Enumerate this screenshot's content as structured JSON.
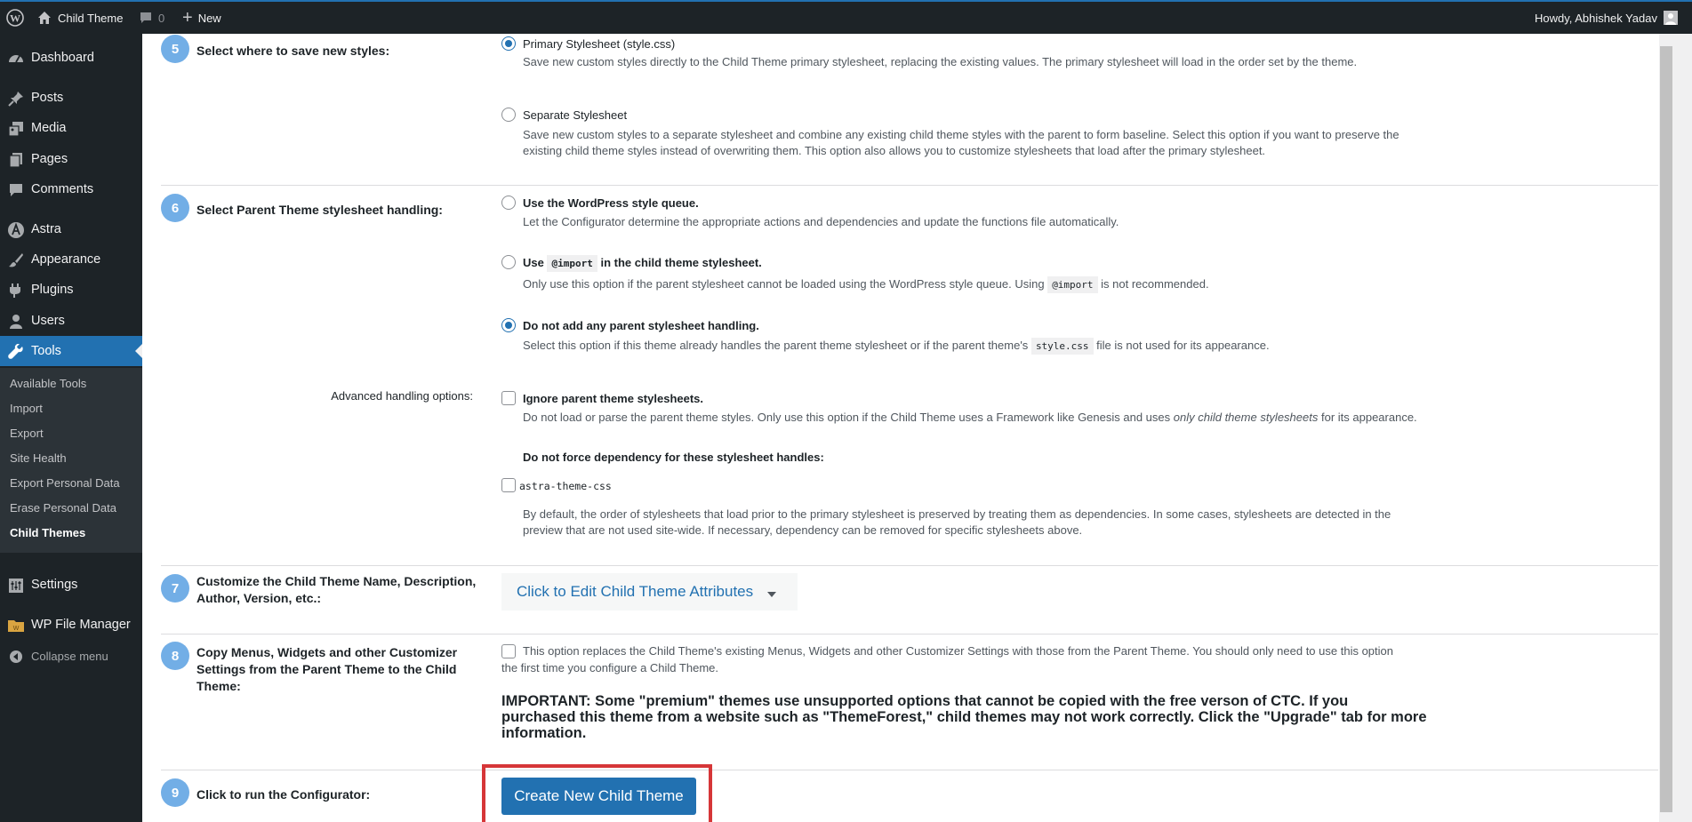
{
  "adminbar": {
    "site_name": "Child Theme",
    "comments_count": "0",
    "new_label": "New",
    "greeting": "Howdy, Abhishek Yadav"
  },
  "sidebar": {
    "items": [
      {
        "label": "Dashboard",
        "icon": "dashboard-icon"
      },
      {
        "label": "Posts",
        "icon": "pin-icon"
      },
      {
        "label": "Media",
        "icon": "media-icon"
      },
      {
        "label": "Pages",
        "icon": "pages-icon"
      },
      {
        "label": "Comments",
        "icon": "comment-icon"
      },
      {
        "label": "Astra",
        "icon": "astra-icon"
      },
      {
        "label": "Appearance",
        "icon": "brush-icon"
      },
      {
        "label": "Plugins",
        "icon": "plugin-icon"
      },
      {
        "label": "Users",
        "icon": "user-icon"
      },
      {
        "label": "Tools",
        "icon": "wrench-icon"
      }
    ],
    "submenu": [
      "Available Tools",
      "Import",
      "Export",
      "Site Health",
      "Export Personal Data",
      "Erase Personal Data",
      "Child Themes"
    ],
    "settings_label": "Settings",
    "file_manager_label": "WP File Manager",
    "collapse_label": "Collapse menu"
  },
  "steps": {
    "s5": {
      "number": "5",
      "label": "Select where to save new styles:",
      "opt1_title": "Primary Stylesheet (style.css)",
      "opt1_desc": "Save new custom styles directly to the Child Theme primary stylesheet, replacing the existing values. The primary stylesheet will load in the order set by the theme.",
      "opt2_title": "Separate Stylesheet",
      "opt2_desc_1": "Save new custom styles to a separate stylesheet and combine any existing child theme styles with the parent to form baseline. Select this option if you want to preserve the",
      "opt2_desc_2": "existing child theme styles instead of overwriting them. This option also allows you to customize stylesheets that load after the primary stylesheet."
    },
    "s6": {
      "number": "6",
      "label": "Select Parent Theme stylesheet handling:",
      "opt1_title": "Use the WordPress style queue.",
      "opt1_desc": "Let the Configurator determine the appropriate actions and dependencies and update the functions file automatically.",
      "opt2_pre": "Use",
      "opt2_code": "@import",
      "opt2_post": "in the child theme stylesheet.",
      "opt2_desc_pre": "Only use this option if the parent stylesheet cannot be loaded using the WordPress style queue. Using",
      "opt2_desc_code": "@import",
      "opt2_desc_post": "is not recommended.",
      "opt3_title": "Do not add any parent stylesheet handling.",
      "opt3_desc_pre": "Select this option if this theme already handles the parent theme stylesheet or if the parent theme's",
      "opt3_desc_code": "style.css",
      "opt3_desc_post": "file is not used for its appearance.",
      "advanced_label": "Advanced handling options:",
      "ignore_title": "Ignore parent theme stylesheets.",
      "ignore_desc_pre": "Do not load or parse the parent theme styles. Only use this option if the Child Theme uses a Framework like Genesis and uses",
      "ignore_desc_em": "only child theme stylesheets",
      "ignore_desc_post": "for its appearance.",
      "noforce_title": "Do not force dependency for these stylesheet handles:",
      "handle": "astra-theme-css",
      "deps_desc_1": "By default, the order of stylesheets that load prior to the primary stylesheet is preserved by treating them as dependencies. In some cases, stylesheets are detected in the",
      "deps_desc_2": "preview that are not used site-wide. If necessary, dependency can be removed for specific stylesheets above."
    },
    "s7": {
      "number": "7",
      "label_1": "Customize the Child Theme Name, Description,",
      "label_2": "Author, Version, etc.:",
      "button": "Click to Edit Child Theme Attributes"
    },
    "s8": {
      "number": "8",
      "label_1": "Copy Menus, Widgets and other Customizer",
      "label_2": "Settings from the Parent Theme to the Child",
      "label_3": "Theme:",
      "desc_1": "This option replaces the Child Theme's existing Menus, Widgets and other Customizer Settings with those from the Parent Theme. You should only need to use this option",
      "desc_2": "the first time you configure a Child Theme.",
      "important_1": "IMPORTANT: Some \"premium\" themes use unsupported options that cannot be copied with the free verson of CTC. If you",
      "important_2": "purchased this theme from a website such as \"ThemeForest,\" child themes may not work correctly. Click the \"Upgrade\" tab for more",
      "important_3": "information."
    },
    "s9": {
      "number": "9",
      "label": "Click to run the Configurator:",
      "button": "Create New Child Theme"
    }
  },
  "colors": {
    "admin_dark": "#1d2327",
    "accent": "#2271b1",
    "step_circle": "#72aee6",
    "highlight_box": "#d63638"
  }
}
